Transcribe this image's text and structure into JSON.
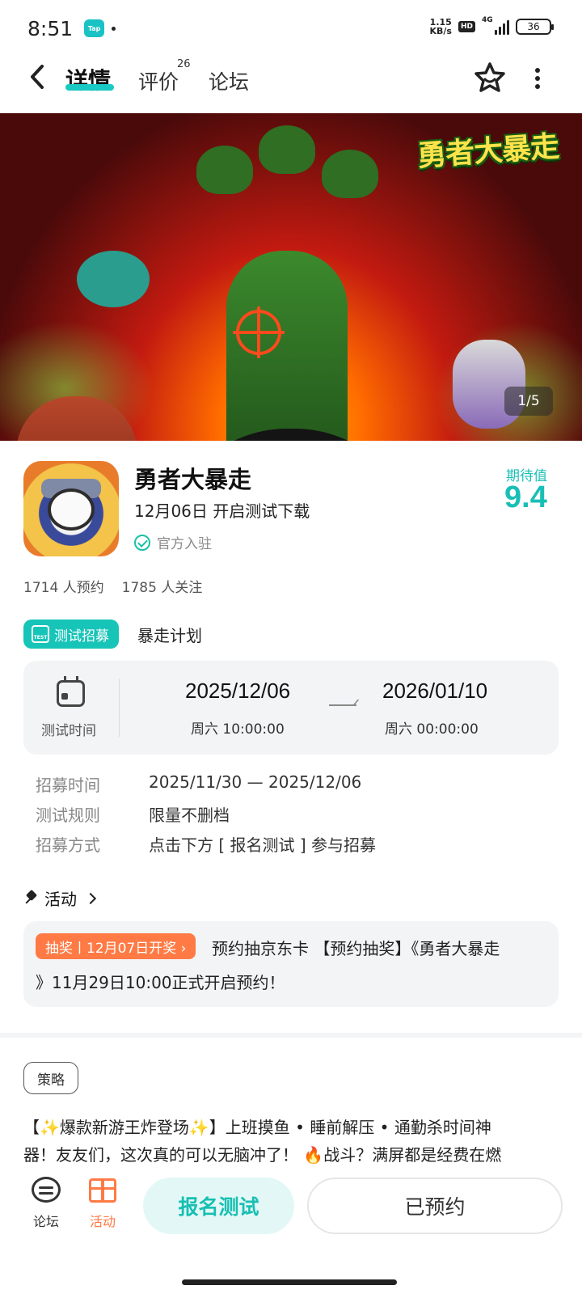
{
  "status_bar": {
    "time": "8:51",
    "tap_badge": "Tap",
    "net_speed_value": "1.15",
    "net_speed_unit": "KB/s",
    "hd": "HD",
    "network": "4G",
    "battery": "36"
  },
  "header": {
    "tabs": [
      {
        "label": "详情",
        "active": true
      },
      {
        "label": "评价",
        "badge": "26"
      },
      {
        "label": "论坛"
      }
    ]
  },
  "banner": {
    "logo_text": "勇者大暴走",
    "counter": "1/5"
  },
  "app": {
    "title": "勇者大暴走",
    "subtitle": "12月06日 开启测试下载",
    "official": "官方入驻",
    "rating_label": "期待值",
    "rating_value": "9.4",
    "stats": [
      "1714 人预约",
      "1785 人关注"
    ]
  },
  "recruit": {
    "badge_label": "测试招募",
    "badge_icon_text": "TEST",
    "plan_name": "暴走计划",
    "time_label": "测试时间",
    "start_date": "2025/12/06",
    "start_sub": "周六  10:00:00",
    "end_date": "2026/01/10",
    "end_sub": "周六  00:00:00",
    "details": [
      {
        "key": "招募时间",
        "value": "2025/11/30 — 2025/12/06"
      },
      {
        "key": "测试规则",
        "value": "限量不删档"
      },
      {
        "key": "招募方式",
        "value": "点击下方 [ 报名测试 ] 参与招募"
      }
    ]
  },
  "activity": {
    "header": "活动",
    "badge": "抽奖丨12月07日开奖 ›",
    "line1": "预约抽京东卡 【预约抽奖】《勇者大暴走",
    "line2": "》11月29日10:00正式开启预约！"
  },
  "strategy": {
    "tag": "策略",
    "lines": [
      "【✨爆款新游王炸登场✨】上班摸鱼 • 睡前解压 • 通勤杀时间神",
      "器！友友们，这次真的可以无脑冲了！ 🔥战斗？满屏都是经费在燃"
    ]
  },
  "bottom_bar": {
    "forum_label": "论坛",
    "activity_label": "活动",
    "signup_label": "报名测试",
    "reserved_label": "已预约"
  },
  "colors": {
    "accent": "#19c9c4",
    "orange": "#ff7a45"
  }
}
